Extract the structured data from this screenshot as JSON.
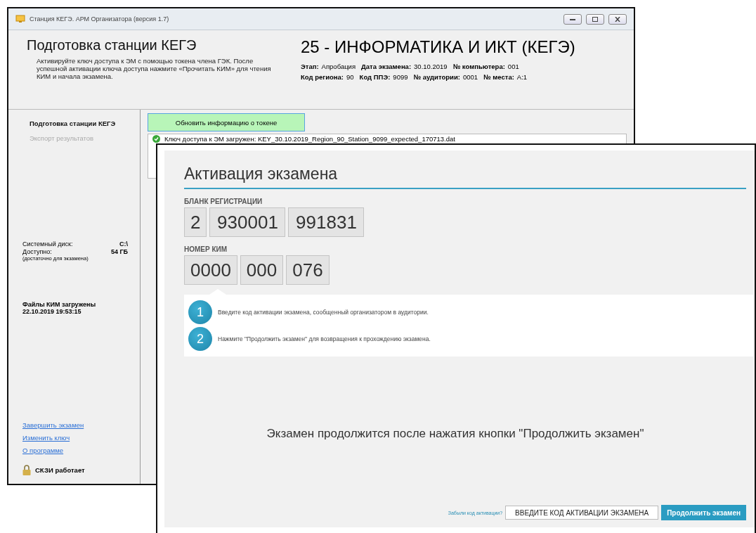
{
  "back_window": {
    "title": "Станция КЕГЭ. АРМ Организатора (версия 1.7)",
    "header": {
      "title": "Подготовка станции КЕГЭ",
      "description": "Активируйте ключ доступа к ЭМ с помощью токена члена ГЭК. После успешной активации ключа доступа нажмите «Прочитать КИМ» для чтения КИМ и начала экзамена.",
      "subject": "25 - ИНФОРМАТИКА И ИКТ (КЕГЭ)",
      "info_lines": [
        [
          {
            "label": "Этап:",
            "value": "Апробация"
          },
          {
            "label": "Дата экзамена:",
            "value": "30.10.2019"
          },
          {
            "label": "№ компьютера:",
            "value": "001"
          }
        ],
        [
          {
            "label": "Код региона:",
            "value": "90"
          },
          {
            "label": "Код ППЭ:",
            "value": "9099"
          },
          {
            "label": "№ аудитории:",
            "value": "0001"
          },
          {
            "label": "№ места:",
            "value": "А:1"
          }
        ]
      ]
    },
    "sidebar": {
      "nav": [
        {
          "label": "Подготовка станции КЕГЭ",
          "selected": true
        },
        {
          "label": "Экспорт результатов",
          "selected": false
        }
      ],
      "disk": [
        {
          "label": "Системный диск:",
          "value": "C:\\"
        },
        {
          "label": "Доступно:",
          "value": "54 ГБ"
        }
      ],
      "disk_note": "(достаточно для экзамена)",
      "files": [
        "Файлы КИМ загружены",
        "22.10.2019 19:53:15"
      ],
      "links": [
        "Завершить экзамен",
        "Изменить ключ",
        "О программе"
      ],
      "status": "СКЗИ работает"
    },
    "token_button": "Обновить информацию о токене",
    "log_entry": "Ключ доступа к ЭМ загружен: KEY_30.10.2019_Region_90_Station_9099_expected_170713.dat"
  },
  "front_window": {
    "title": "Активация экзамена",
    "registration": {
      "label": "БЛАНК РЕГИСТРАЦИИ",
      "fields": [
        "2",
        "930001",
        "991831"
      ]
    },
    "kim": {
      "label": "НОМЕР КИМ",
      "fields": [
        "0000",
        "000",
        "076"
      ]
    },
    "steps": [
      {
        "number": "1",
        "text": "Введите код активации экзамена, сообщенный организатором в аудитории."
      },
      {
        "number": "2",
        "text": "Нажмите \"Продолжить экзамен\" для возвращения к прохождению экзамена."
      }
    ],
    "message": "Экзамен продолжится после нажатия кнопки \"Продолжить экзамен\"",
    "forgot_link": "Забыли код активации?",
    "code_field": {
      "placeholder": "ВВЕДИТЕ КОД АКТИВАЦИИ ЭКЗАМЕНА"
    },
    "continue_button": "Продолжить экзамен"
  }
}
